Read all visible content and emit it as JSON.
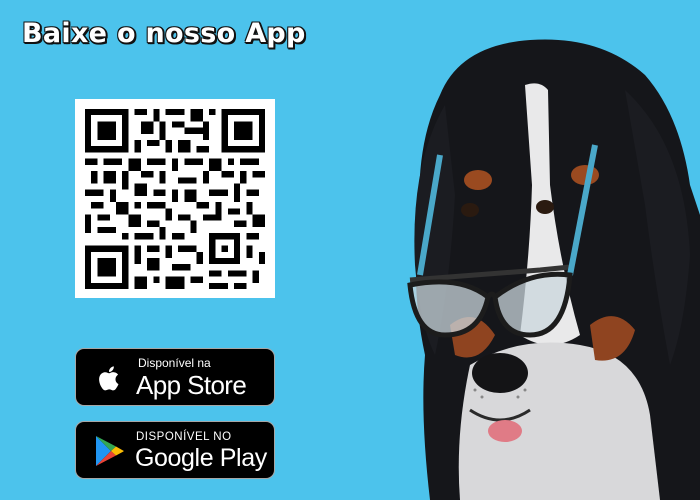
{
  "header": {
    "title": "Baixe o nosso App"
  },
  "qr": {
    "icon": "qr-code"
  },
  "badges": {
    "appstore": {
      "small": "Disponível na",
      "big": "App Store",
      "icon": "apple-icon"
    },
    "play": {
      "small": "DISPONÍVEL NO",
      "big": "Google Play",
      "icon": "google-play-icon"
    }
  },
  "colors": {
    "background": "#4cc3ec",
    "badge": "#000000",
    "title": "#ffffff"
  }
}
